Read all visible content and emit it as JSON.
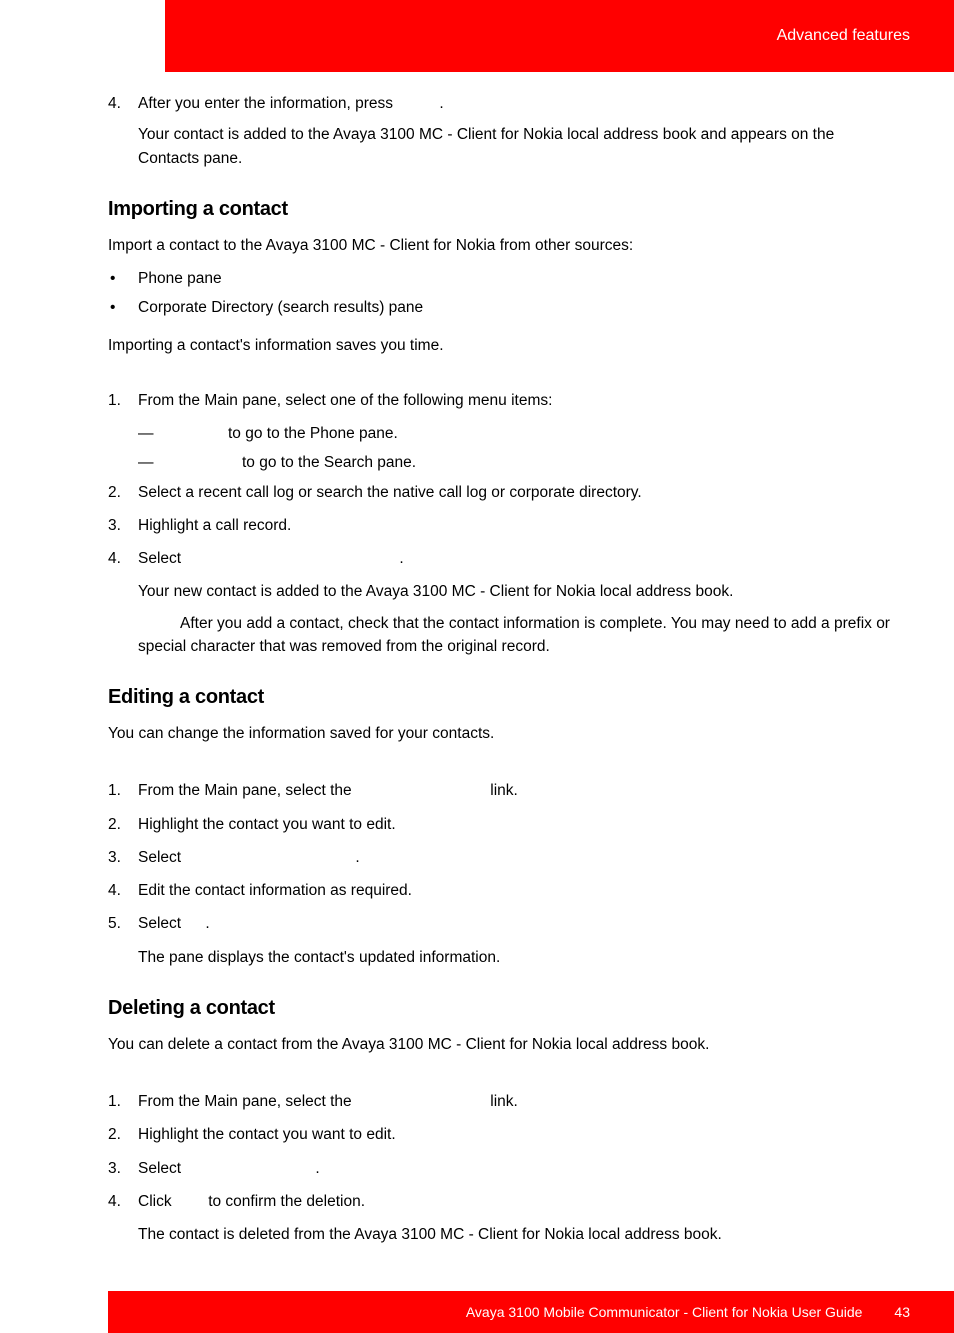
{
  "header": {
    "section_title": "Advanced features"
  },
  "section_top": {
    "step4_num": "4.",
    "step4_text_a": "After you enter the information, press ",
    "step4_text_c": ".",
    "step4_cont": "Your contact is added to the Avaya 3100 MC - Client for Nokia local address book and appears on the Contacts pane."
  },
  "importing": {
    "heading": "Importing a contact",
    "intro": "Import a contact to the Avaya 3100 MC - Client for Nokia from other sources:",
    "bullet1": "Phone pane",
    "bullet2": "Corporate Directory (search results) pane",
    "note": "Importing a contact's information saves you time.",
    "steps": {
      "s1_num": "1.",
      "s1_text": "From the Main pane, select one of the following menu items:",
      "s1_sub1_dash": "—",
      "s1_sub1_text": "to go to the Phone pane.",
      "s1_sub2_dash": "—",
      "s1_sub2_text": "to go to the Search pane.",
      "s2_num": "2.",
      "s2_text": "Select a recent call log or search the native call log or corporate directory.",
      "s3_num": "3.",
      "s3_text": "Highlight a call record.",
      "s4_num": "4.",
      "s4_text_a": "Select ",
      "s4_text_c": ".",
      "s4_cont": "Your new contact is added to the Avaya 3100 MC - Client for Nokia local address book."
    },
    "after_note": "After you add a contact, check that the contact information is complete. You may need to add a prefix or special character that was removed from the original record."
  },
  "editing": {
    "heading": "Editing a contact",
    "intro": "You can change the information saved for your contacts.",
    "steps": {
      "s1_num": "1.",
      "s1_text_a": "From the Main pane, select the ",
      "s1_text_c": " link.",
      "s2_num": "2.",
      "s2_text": "Highlight the contact you want to edit.",
      "s3_num": "3.",
      "s3_text_a": "Select ",
      "s3_text_c": ".",
      "s4_num": "4.",
      "s4_text": "Edit the contact information as required.",
      "s5_num": "5.",
      "s5_text_a": "Select ",
      "s5_text_c": ".",
      "s5_cont": "The pane displays the contact's updated information."
    }
  },
  "deleting": {
    "heading": "Deleting a contact",
    "intro": "You can delete a contact from the Avaya 3100 MC - Client for Nokia local address book.",
    "steps": {
      "s1_num": "1.",
      "s1_text_a": "From the Main pane, select the ",
      "s1_text_c": " link.",
      "s2_num": "2.",
      "s2_text": "Highlight the contact you want to edit.",
      "s3_num": "3.",
      "s3_text_a": "Select ",
      "s3_text_c": ".",
      "s4_num": "4.",
      "s4_text_a": "Click ",
      "s4_text_c": " to confirm the deletion.",
      "s4_cont": "The contact is deleted from the Avaya 3100 MC - Client for Nokia local address book."
    }
  },
  "footer": {
    "doc_title": "Avaya 3100 Mobile Communicator - Client for Nokia User Guide",
    "page": "43"
  }
}
